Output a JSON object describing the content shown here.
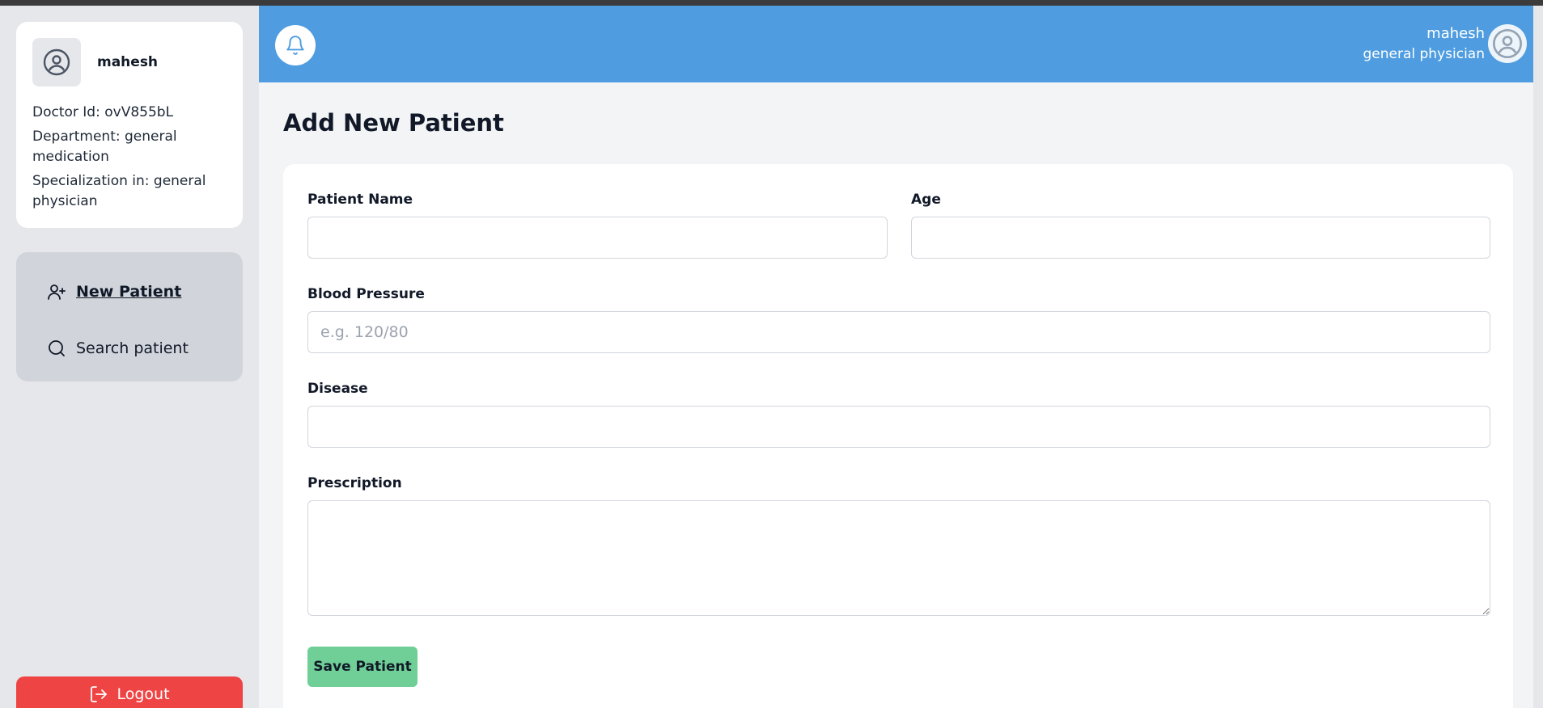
{
  "sidebar": {
    "profile": {
      "name": "mahesh",
      "doctor_id": "Doctor Id: ovV855bL",
      "department": "Department: general medication",
      "specialization": "Specialization in: general physician"
    },
    "nav": [
      {
        "label": "New Patient",
        "icon": "user-plus-icon",
        "active": true
      },
      {
        "label": "Search patient",
        "icon": "search-icon",
        "active": false
      }
    ],
    "logout_label": "Logout"
  },
  "header": {
    "user_name": "mahesh",
    "user_role": "general physician",
    "accent_color": "#4f9de0"
  },
  "main": {
    "title": "Add New Patient",
    "form": {
      "patient_name_label": "Patient Name",
      "patient_name_value": "",
      "age_label": "Age",
      "age_value": "",
      "blood_pressure_label": "Blood Pressure",
      "blood_pressure_placeholder": "e.g. 120/80",
      "disease_label": "Disease",
      "disease_value": "",
      "prescription_label": "Prescription",
      "prescription_value": "",
      "save_label": "Save Patient"
    }
  },
  "colors": {
    "logout": "#ef4444",
    "save": "#6fcf97"
  }
}
